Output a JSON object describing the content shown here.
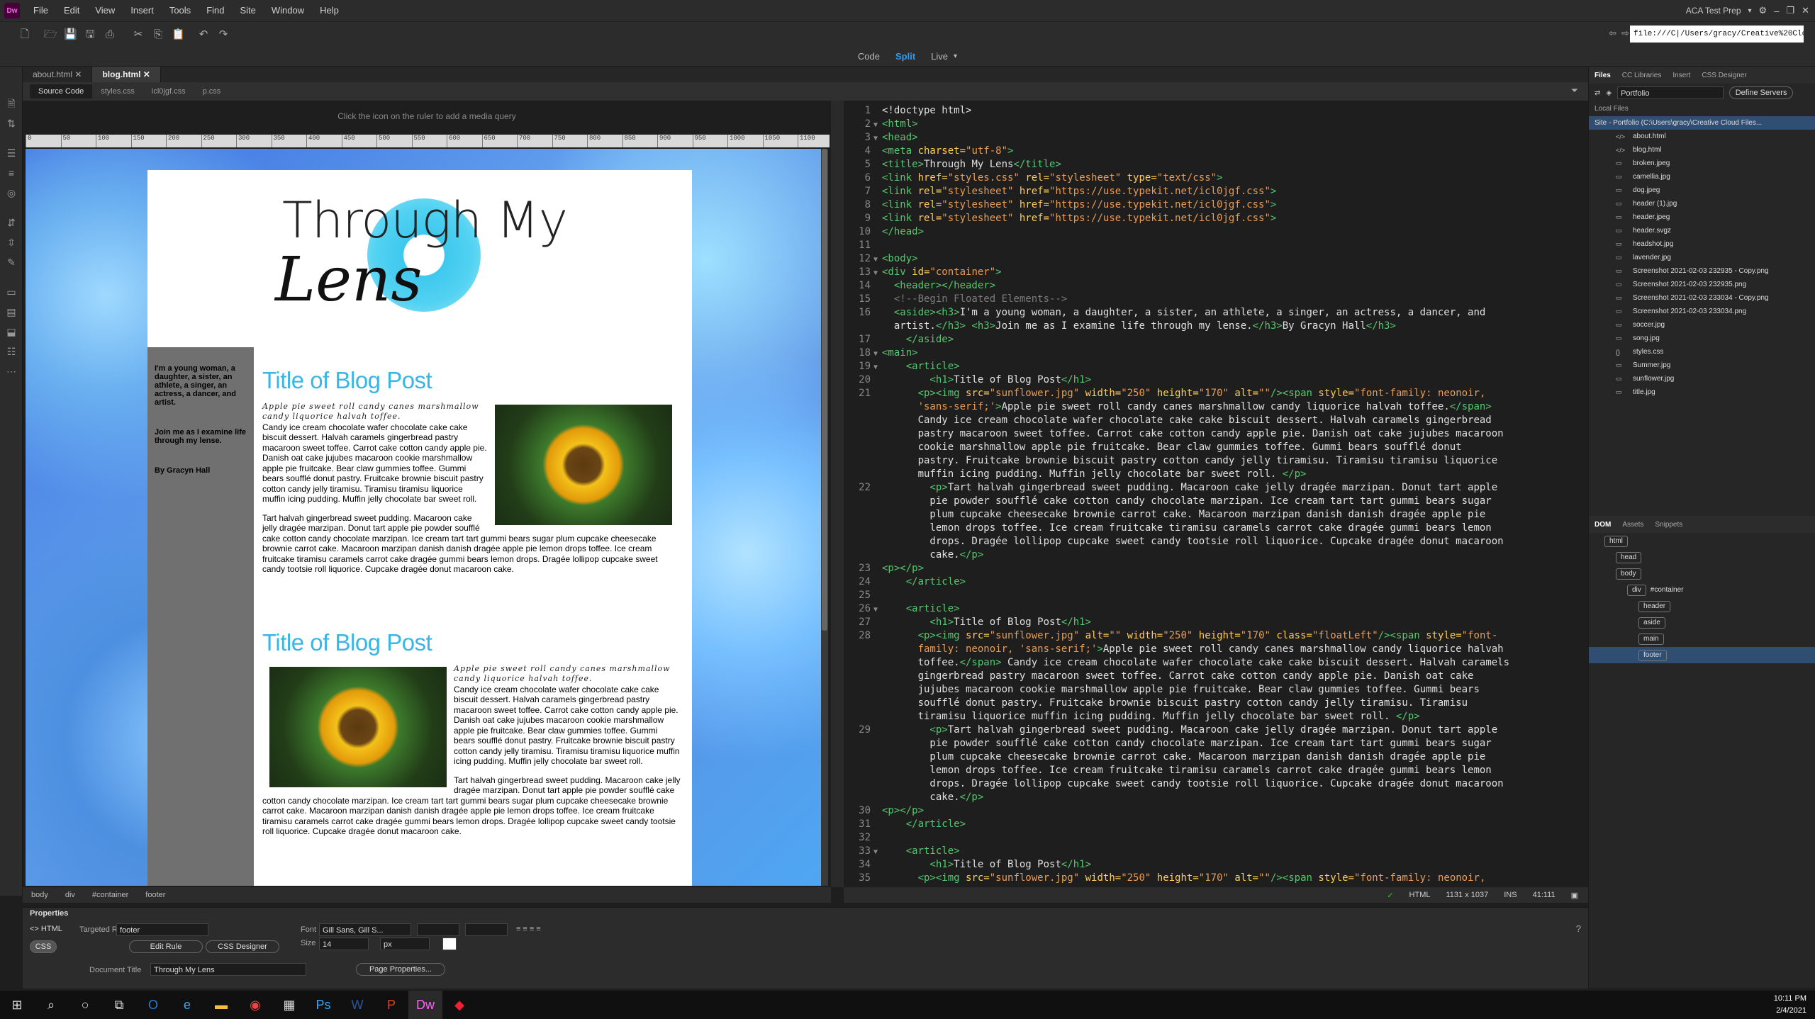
{
  "app": {
    "logo": "Dw",
    "menus": [
      "File",
      "Edit",
      "View",
      "Insert",
      "Tools",
      "Find",
      "Site",
      "Window",
      "Help"
    ],
    "workspace": "ACA Test Prep"
  },
  "address": "file:///C|/Users/gracy/Creative%20Cloud%2",
  "views": {
    "code": "Code",
    "split": "Split",
    "live": "Live"
  },
  "tabs": [
    "about.html",
    "blog.html"
  ],
  "related": [
    "Source Code",
    "styles.css",
    "icl0jgf.css",
    "p.css"
  ],
  "mq_hint": "Click the      icon on the ruler to add a media query",
  "ruler": [
    "0",
    "50",
    "100",
    "150",
    "200",
    "250",
    "300",
    "350",
    "400",
    "450",
    "500",
    "550",
    "600",
    "650",
    "700",
    "750",
    "800",
    "850",
    "900",
    "950",
    "1000",
    "1050",
    "1100"
  ],
  "page": {
    "logo_title": "Through My",
    "logo_script": "Lens",
    "sidebar": [
      "I'm a young woman, a daughter, a sister, an athlete, a singer, an actress, a dancer, and artist.",
      "Join me as I examine life through my lense.",
      "By Gracyn Hall"
    ],
    "articles": [
      {
        "title": "Title of Blog Post",
        "script": "Apple pie sweet roll candy canes marshmallow candy liquorice halvah toffee.",
        "p1": "Candy ice cream chocolate wafer chocolate cake cake biscuit dessert. Halvah caramels gingerbread pastry macaroon sweet toffee. Carrot cake cotton candy apple pie. Danish oat cake jujubes macaroon cookie marshmallow apple pie fruitcake. Bear claw gummies toffee. Gummi bears soufflé donut pastry. Fruitcake brownie biscuit pastry cotton candy jelly tiramisu. Tiramisu tiramisu liquorice muffin icing pudding. Muffin jelly chocolate bar sweet roll.",
        "p2": "Tart halvah gingerbread sweet pudding. Macaroon cake jelly dragée marzipan. Donut tart apple pie powder soufflé cake cotton candy chocolate marzipan. Ice cream tart tart gummi bears sugar plum cupcake cheesecake brownie carrot cake. Macaroon marzipan danish danish dragée apple pie lemon drops toffee. Ice cream fruitcake tiramisu caramels carrot cake dragée gummi bears lemon drops. Dragée lollipop cupcake sweet candy tootsie roll liquorice. Cupcake dragée donut macaroon cake."
      },
      {
        "title": "Title of Blog Post",
        "script": "Apple pie sweet roll candy canes marshmallow candy liquorice halvah toffee.",
        "p1": "Candy ice cream chocolate wafer chocolate cake cake biscuit dessert. Halvah caramels gingerbread pastry macaroon sweet toffee. Carrot cake cotton candy apple pie. Danish oat cake jujubes macaroon cookie marshmallow apple pie fruitcake. Bear claw gummies toffee. Gummi bears soufflé donut pastry. Fruitcake brownie biscuit pastry cotton candy jelly tiramisu. Tiramisu tiramisu liquorice muffin icing pudding. Muffin jelly chocolate bar sweet roll.",
        "p2": "Tart halvah gingerbread sweet pudding. Macaroon cake jelly dragée marzipan. Donut tart apple pie powder soufflé cake cotton candy chocolate marzipan. Ice cream tart tart gummi bears sugar plum cupcake cheesecake brownie carrot cake. Macaroon marzipan danish danish dragée apple pie lemon drops toffee. Ice cream fruitcake tiramisu caramels carrot cake dragée gummi bears lemon drops. Dragée lollipop cupcake sweet candy tootsie roll liquorice. Cupcake dragée donut macaroon cake."
      }
    ]
  },
  "tagbar": [
    "body",
    "div",
    "#container",
    "footer"
  ],
  "code_status": {
    "lang": "HTML",
    "size": "1131 x 1037",
    "mode": "INS",
    "pos": "41:111"
  },
  "properties": {
    "title": "Properties",
    "html": "HTML",
    "css": "CSS",
    "targeted_rule_label": "Targeted Rule",
    "targeted_rule": "footer",
    "edit_rule": "Edit Rule",
    "css_designer": "CSS Designer",
    "font_label": "Font",
    "font": "Gill Sans, Gill S...",
    "size_label": "Size",
    "size": "14",
    "unit": "px",
    "doc_title_label": "Document Title",
    "doc_title": "Through My Lens",
    "page_props": "Page Properties..."
  },
  "files_panel": {
    "tabs": [
      "Files",
      "CC Libraries",
      "Insert",
      "CSS Designer"
    ],
    "site": "Portfolio",
    "define": "Define Servers",
    "local": "Local Files",
    "root": "Site - Portfolio (C:\\Users\\gracy\\Creative Cloud Files...",
    "files": [
      "about.html",
      "blog.html",
      "broken.jpeg",
      "camellia.jpg",
      "dog.jpeg",
      "header (1).jpg",
      "header.jpeg",
      "header.svgz",
      "headshot.jpg",
      "lavender.jpg",
      "Screenshot 2021-02-03 232935 - Copy.png",
      "Screenshot 2021-02-03 232935.png",
      "Screenshot 2021-02-03 233034 - Copy.png",
      "Screenshot 2021-02-03 233034.png",
      "soccer.jpg",
      "song.jpg",
      "styles.css",
      "Summer.jpg",
      "sunflower.jpg",
      "title.jpg"
    ]
  },
  "dom_panel": {
    "tabs": [
      "DOM",
      "Assets",
      "Snippets"
    ],
    "nodes": [
      {
        "tag": "html",
        "indent": 0
      },
      {
        "tag": "head",
        "indent": 1
      },
      {
        "tag": "body",
        "indent": 1
      },
      {
        "tag": "div",
        "extra": "#container",
        "indent": 2
      },
      {
        "tag": "header",
        "indent": 3
      },
      {
        "tag": "aside",
        "indent": 3
      },
      {
        "tag": "main",
        "indent": 3
      },
      {
        "tag": "footer",
        "indent": 3
      }
    ]
  },
  "clock": {
    "time": "10:11 PM",
    "date": "2/4/2021"
  }
}
